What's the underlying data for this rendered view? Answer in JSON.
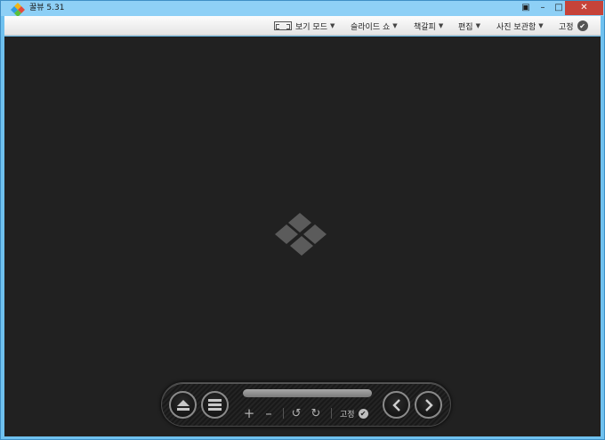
{
  "window": {
    "title": "꿀뷰 5.31",
    "controls": {
      "fullscreen": "▣",
      "minimize": "–",
      "maximize": "□",
      "close": "✕"
    }
  },
  "menubar": {
    "items": [
      {
        "label": "보기 모드",
        "icon": "view-mode-icon"
      },
      {
        "label": "슬라이드 쇼"
      },
      {
        "label": "책갈피"
      },
      {
        "label": "편집"
      },
      {
        "label": "사진 보관함"
      }
    ],
    "arrow": "▼",
    "pin": {
      "label": "고정",
      "check": "✔"
    }
  },
  "viewer": {
    "background": "#212121",
    "logo": "honeyview-logo"
  },
  "controlbar": {
    "buttons": {
      "eject": "eject-icon",
      "menu": "menu-icon",
      "prev": "chevron-left-icon",
      "next": "chevron-right-icon"
    },
    "zoom_in": "+",
    "zoom_out": "–",
    "rotate_left": "↺",
    "rotate_right": "↻",
    "pin": {
      "label": "고정",
      "check": "✔"
    }
  },
  "colors": {
    "titlebar": "#8ed0f6",
    "close_button": "#c6433a",
    "viewer_bg": "#212121"
  }
}
